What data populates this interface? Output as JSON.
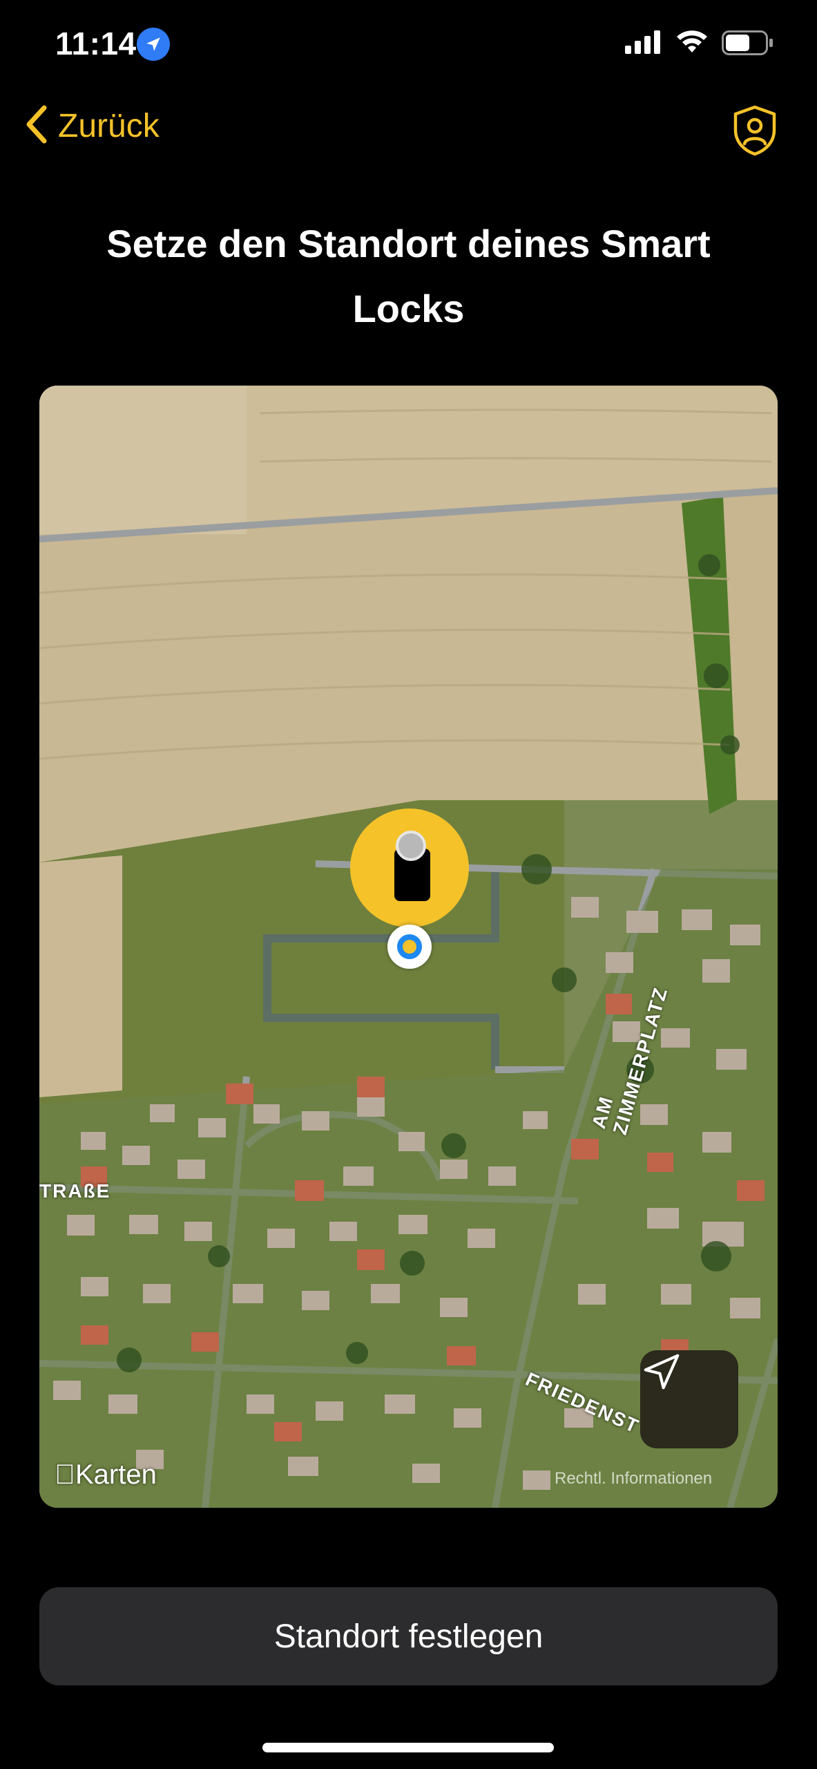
{
  "status_bar": {
    "time": "11:14"
  },
  "nav": {
    "back_label": "Zurück"
  },
  "page": {
    "title": "Setze den Standort deines Smart Locks"
  },
  "map": {
    "street_labels": [
      "TRAßE",
      "AM ZIMMERPLATZ",
      "FRIEDENST"
    ],
    "attribution": "Karten",
    "legal": "Rechtl. Informationen"
  },
  "footer": {
    "confirm_label": "Standort festlegen"
  },
  "colors": {
    "accent": "#f5c229",
    "user_location": "#1e88f0",
    "button_bg": "#2c2c2e"
  }
}
